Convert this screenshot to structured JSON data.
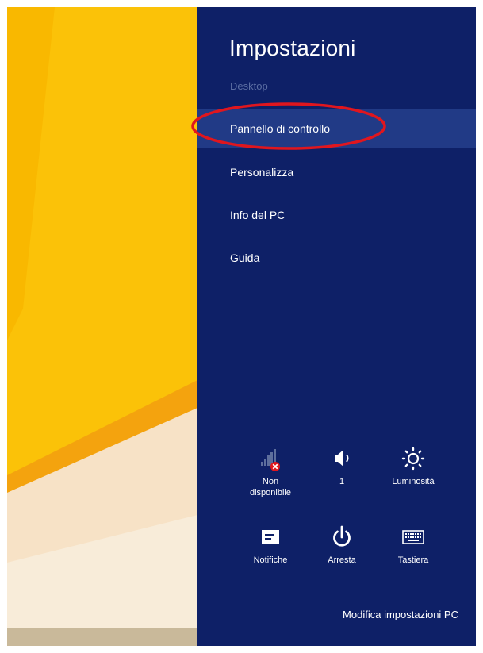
{
  "charm": {
    "title": "Impostazioni",
    "context": "Desktop",
    "menu": [
      {
        "label": "Pannello di controllo",
        "selected": true
      },
      {
        "label": "Personalizza"
      },
      {
        "label": "Info del PC"
      },
      {
        "label": "Guida"
      }
    ],
    "quick_settings": [
      {
        "label": "Non disponibile",
        "icon": "network-unavailable-icon"
      },
      {
        "label": "1",
        "icon": "volume-icon"
      },
      {
        "label": "Luminosità",
        "icon": "brightness-icon"
      },
      {
        "label": "Notifiche",
        "icon": "notifications-icon"
      },
      {
        "label": "Arresta",
        "icon": "power-icon"
      },
      {
        "label": "Tastiera",
        "icon": "keyboard-icon"
      }
    ],
    "footer_link": "Modifica impostazioni PC"
  },
  "colors": {
    "panel": "#0e2067",
    "selected_row": "#213a86",
    "annotation": "#e0161e",
    "wallpaper_yellow": "#fbc208"
  }
}
